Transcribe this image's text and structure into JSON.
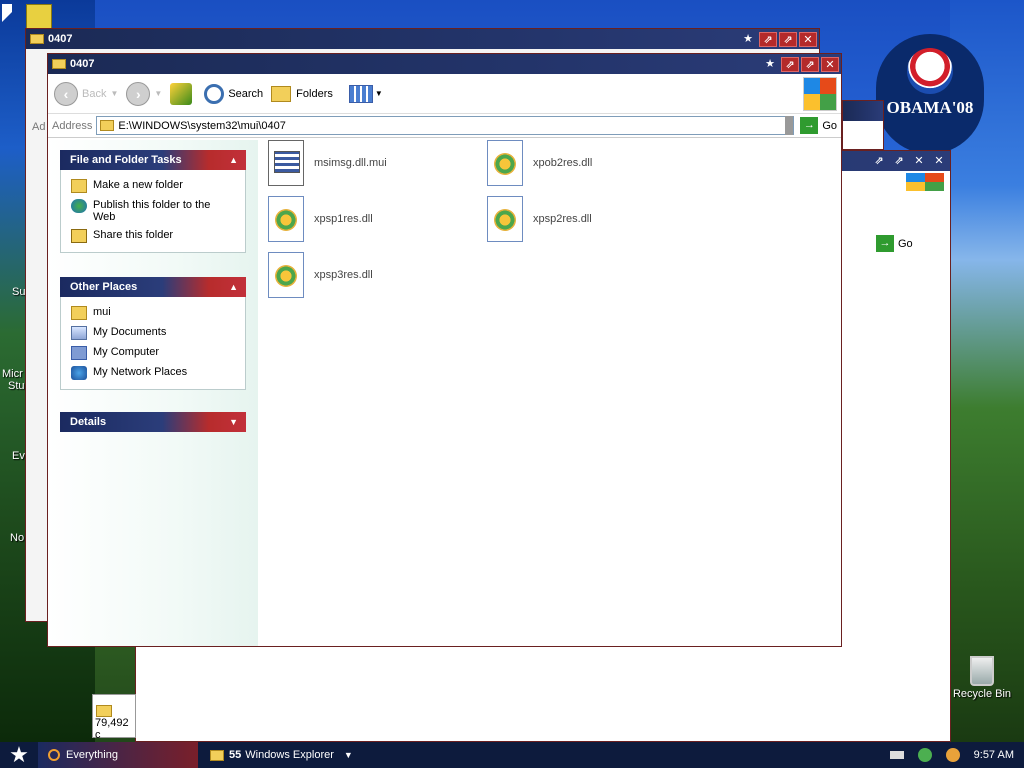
{
  "main_window": {
    "title": "0407",
    "toolbar": {
      "back_label": "Back",
      "search_label": "Search",
      "folders_label": "Folders"
    },
    "address": {
      "label": "Address",
      "path": "E:\\WINDOWS\\system32\\mui\\0407",
      "go_label": "Go"
    },
    "task_panels": {
      "file_folder_tasks": {
        "title": "File and Folder Tasks",
        "items": [
          {
            "label": "Make a new folder",
            "icon": "folder-new-icon"
          },
          {
            "label": "Publish this folder to the Web",
            "icon": "globe-icon"
          },
          {
            "label": "Share this folder",
            "icon": "share-folder-icon"
          }
        ]
      },
      "other_places": {
        "title": "Other Places",
        "items": [
          {
            "label": "mui",
            "icon": "folder-icon"
          },
          {
            "label": "My Documents",
            "icon": "my-documents-icon"
          },
          {
            "label": "My Computer",
            "icon": "my-computer-icon"
          },
          {
            "label": "My Network Places",
            "icon": "network-places-icon"
          }
        ]
      },
      "details": {
        "title": "Details"
      }
    },
    "files": [
      {
        "name": "msimsg.dll.mui",
        "type": "mui"
      },
      {
        "name": "xpob2res.dll",
        "type": "dll"
      },
      {
        "name": "xpsp1res.dll",
        "type": "dll"
      },
      {
        "name": "xpsp2res.dll",
        "type": "dll"
      },
      {
        "name": "xpsp3res.dll",
        "type": "dll"
      }
    ]
  },
  "background_windows": {
    "title": "0407",
    "address_partial": "Ad",
    "go_label": "Go",
    "status_partial": "79,492 c"
  },
  "desktop": {
    "obama_text": "OBAMA'08",
    "recycle_bin_label": "Recycle Bin",
    "left_partial_labels": [
      "Su",
      "Micr",
      "Stu",
      "Ev",
      "No"
    ]
  },
  "taskbar": {
    "quick_launch_label": "Everything",
    "task_count": "55",
    "task_label": "Windows Explorer",
    "clock": "9:57 AM"
  },
  "colors": {
    "titlebar": "#1b2a55",
    "accent_red": "#b72c2c",
    "taskbar": "#0d1b3d"
  }
}
